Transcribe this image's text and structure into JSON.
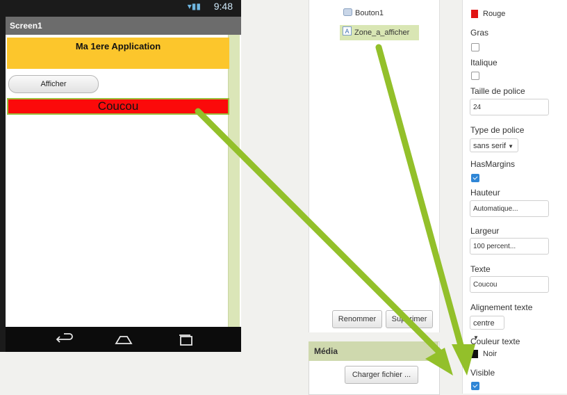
{
  "phone": {
    "status_time": "9:48",
    "screen_title": "Screen1",
    "app_title": "Ma 1ere Application",
    "button_label": "Afficher",
    "label_text": "Coucou"
  },
  "components": {
    "items": [
      {
        "name": "Bouton1",
        "icon": "button-icon"
      },
      {
        "name": "Zone_a_afficher",
        "icon": "label-icon",
        "selected": true
      }
    ],
    "rename_button": "Renommer",
    "delete_button": "Supprimer"
  },
  "media": {
    "title": "Média",
    "upload_button": "Charger fichier ..."
  },
  "properties": {
    "background_color": {
      "value": "Rouge",
      "color": "#e11414"
    },
    "bold": {
      "label": "Gras",
      "checked": false
    },
    "italic": {
      "label": "Italique",
      "checked": false
    },
    "font_size": {
      "label": "Taille de police",
      "value": "24"
    },
    "font_type": {
      "label": "Type de police",
      "value": "sans serif"
    },
    "has_margins": {
      "label": "HasMargins",
      "checked": true
    },
    "height": {
      "label": "Hauteur",
      "value": "Automatique..."
    },
    "width": {
      "label": "Largeur",
      "value": "100 percent..."
    },
    "text": {
      "label": "Texte",
      "value": "Coucou"
    },
    "text_align": {
      "label": "Alignement texte",
      "value": "centre"
    },
    "text_color": {
      "label": "Couleur texte",
      "value": "Noir",
      "color": "#111111"
    },
    "visible": {
      "label": "Visible",
      "checked": true
    }
  },
  "colors": {
    "arrow": "#93c02a",
    "header_yellow": "#fcc62c",
    "label_red": "#fb0a0a",
    "selection_green": "#d9e6b4"
  }
}
